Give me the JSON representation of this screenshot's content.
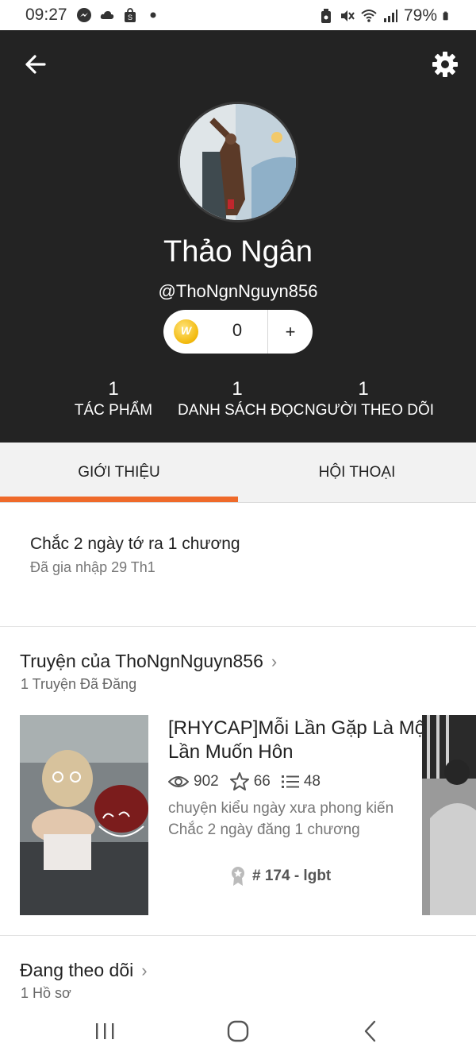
{
  "status_bar": {
    "time": "09:27",
    "battery": "79%",
    "left_icons": [
      "messenger-icon",
      "cloud-icon",
      "shopping-bag-icon",
      "dot-icon"
    ],
    "right_icons": [
      "lock-battery-icon",
      "mute-icon",
      "wifi-icon",
      "signal-icon",
      "battery-icon"
    ]
  },
  "header": {
    "display_name": "Thảo Ngân",
    "username": "@ThoNgnNguyn856",
    "coins": "0",
    "coin_add": "+",
    "coin_symbol": "W",
    "stats": [
      {
        "count": "1",
        "label": "TÁC PHẨM"
      },
      {
        "count": "1",
        "label": "DANH SÁCH ĐỌC"
      },
      {
        "count": "1",
        "label": "NGƯỜI THEO DÕI"
      }
    ]
  },
  "tabs": [
    {
      "label": "GIỚI THIỆU",
      "active": true
    },
    {
      "label": "HỘI THOẠI",
      "active": false
    }
  ],
  "about": {
    "description": "Chắc 2 ngày tớ ra 1 chương",
    "joined": "Đã gia nhập 29 Th1"
  },
  "stories_section": {
    "title": "Truyện của ThoNgnNguyn856",
    "subtitle": "1 Truyện Đã Đăng",
    "story": {
      "title": "[RHYCAP]Mỗi Lần Gặp Là Một Lần Muốn Hôn",
      "reads": "902",
      "votes": "66",
      "parts": "48",
      "description": "chuyện kiểu ngày xưa phong kiến",
      "update": "Chắc 2 ngày đăng 1 chương",
      "rank": "# 174 - lgbt"
    }
  },
  "following_section": {
    "title": "Đang theo dõi",
    "subtitle": "1 Hồ sơ"
  },
  "colors": {
    "accent": "#ef6a2a",
    "header_bg": "#232323",
    "tab_bg": "#f2f2f2"
  }
}
